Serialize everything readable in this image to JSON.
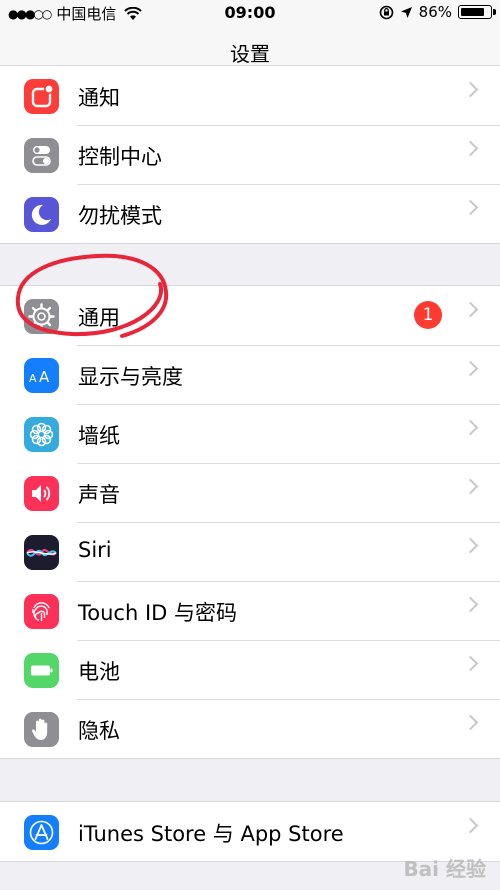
{
  "status_bar": {
    "signal": "●●●○○",
    "carrier": "中国电信",
    "time": "09:00",
    "battery_percent": "86%",
    "battery_level": 0.86
  },
  "nav": {
    "title": "设置"
  },
  "groups": [
    [
      {
        "label": "通知",
        "icon": "notifications-icon",
        "color": "#fc3d39"
      },
      {
        "label": "控制中心",
        "icon": "control-center-icon",
        "color": "#8e8e93"
      },
      {
        "label": "勿扰模式",
        "icon": "moon-icon",
        "color": "#5856d6"
      }
    ],
    [
      {
        "label": "通用",
        "icon": "gear-icon",
        "color": "#8e8e93",
        "badge": "1"
      },
      {
        "label": "显示与亮度",
        "icon": "display-brightness-icon",
        "color": "#147efb"
      },
      {
        "label": "墙纸",
        "icon": "wallpaper-flower-icon",
        "color": "#35aadc"
      },
      {
        "label": "声音",
        "icon": "speaker-icon",
        "color": "#fc3158"
      },
      {
        "label": "Siri",
        "icon": "siri-icon",
        "color": "#1c1c2e"
      },
      {
        "label": "Touch ID 与密码",
        "icon": "fingerprint-icon",
        "color": "#fc3158"
      },
      {
        "label": "电池",
        "icon": "battery-icon",
        "color": "#53d769"
      },
      {
        "label": "隐私",
        "icon": "hand-icon",
        "color": "#8e8e93"
      }
    ],
    [
      {
        "label": "iTunes Store 与 App Store",
        "icon": "app-store-icon",
        "color": "#147efb"
      }
    ]
  ],
  "annotation_color": "#e8263a",
  "watermark": "Bai 经验"
}
